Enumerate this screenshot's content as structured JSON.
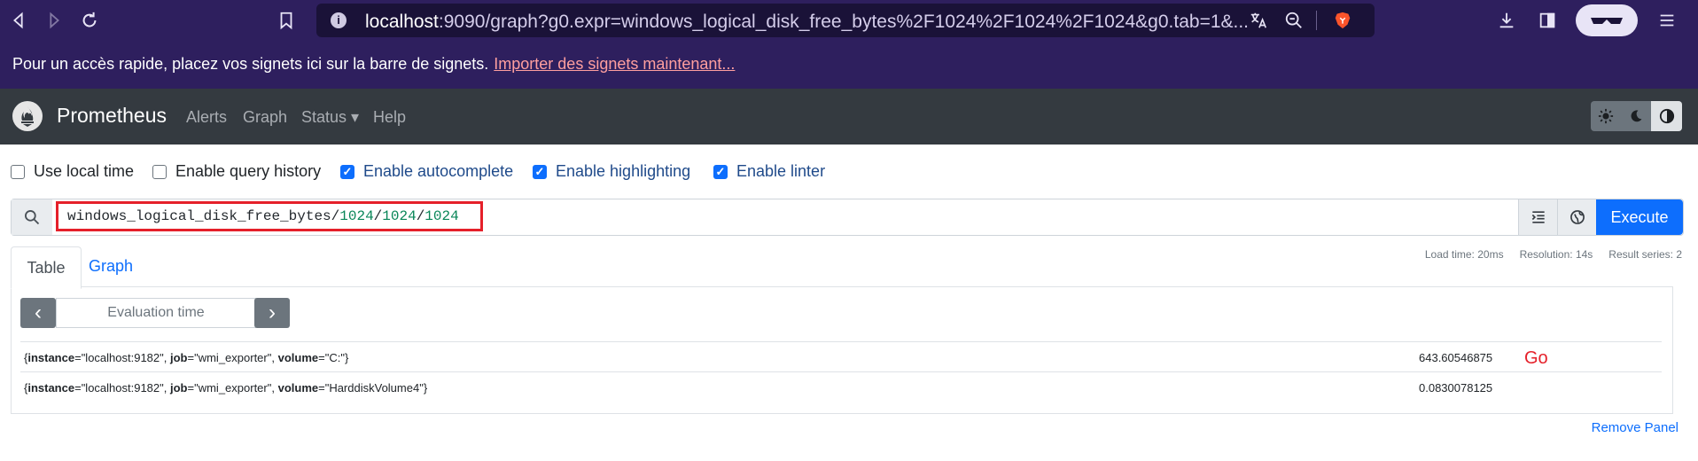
{
  "browser": {
    "url_host": "localhost",
    "url_rest": ":9090/graph?g0.expr=windows_logical_disk_free_bytes%2F1024%2F1024%2F1024&g0.tab=1&...",
    "info_icon": "i"
  },
  "bookmarks": {
    "text": "Pour un accès rapide, placez vos signets ici sur la barre de signets.",
    "link": "Importer des signets maintenant..."
  },
  "navbar": {
    "brand": "Prometheus",
    "links": [
      "Alerts",
      "Graph",
      "Status",
      "Help"
    ],
    "status_caret": "▾"
  },
  "options": [
    {
      "label": "Use local time",
      "checked": false
    },
    {
      "label": "Enable query history",
      "checked": false
    },
    {
      "label": "Enable autocomplete",
      "checked": true
    },
    {
      "label": "Enable highlighting",
      "checked": true
    },
    {
      "label": "Enable linter",
      "checked": true
    }
  ],
  "expression": {
    "metric": "windows_logical_disk_free_bytes",
    "op": "/",
    "n1": "1024",
    "n2": "1024",
    "n3": "1024"
  },
  "execute_label": "Execute",
  "tabs": {
    "table": "Table",
    "graph": "Graph"
  },
  "stats": {
    "load_time": "Load time: 20ms",
    "resolution": "Resolution: 14s",
    "result_series": "Result series: 2"
  },
  "eval": {
    "placeholder": "Evaluation time",
    "prev": "‹",
    "next": "›"
  },
  "results": [
    {
      "k1": "instance",
      "v1": "\"localhost:9182\"",
      "k2": "job",
      "v2": "\"wmi_exporter\"",
      "k3": "volume",
      "v3": "\"C:\"",
      "value": "643.60546875"
    },
    {
      "k1": "instance",
      "v1": "\"localhost:9182\"",
      "k2": "job",
      "v2": "\"wmi_exporter\"",
      "k3": "volume",
      "v3": "\"HarddiskVolume4\"",
      "value": "0.0830078125"
    }
  ],
  "annotation": "Go",
  "remove_panel": "Remove Panel",
  "colors": {
    "accent": "#0d6efd",
    "highlight_box": "#e5202a",
    "browser_bg": "#2e1f5e",
    "navbar_bg": "#343a40"
  }
}
